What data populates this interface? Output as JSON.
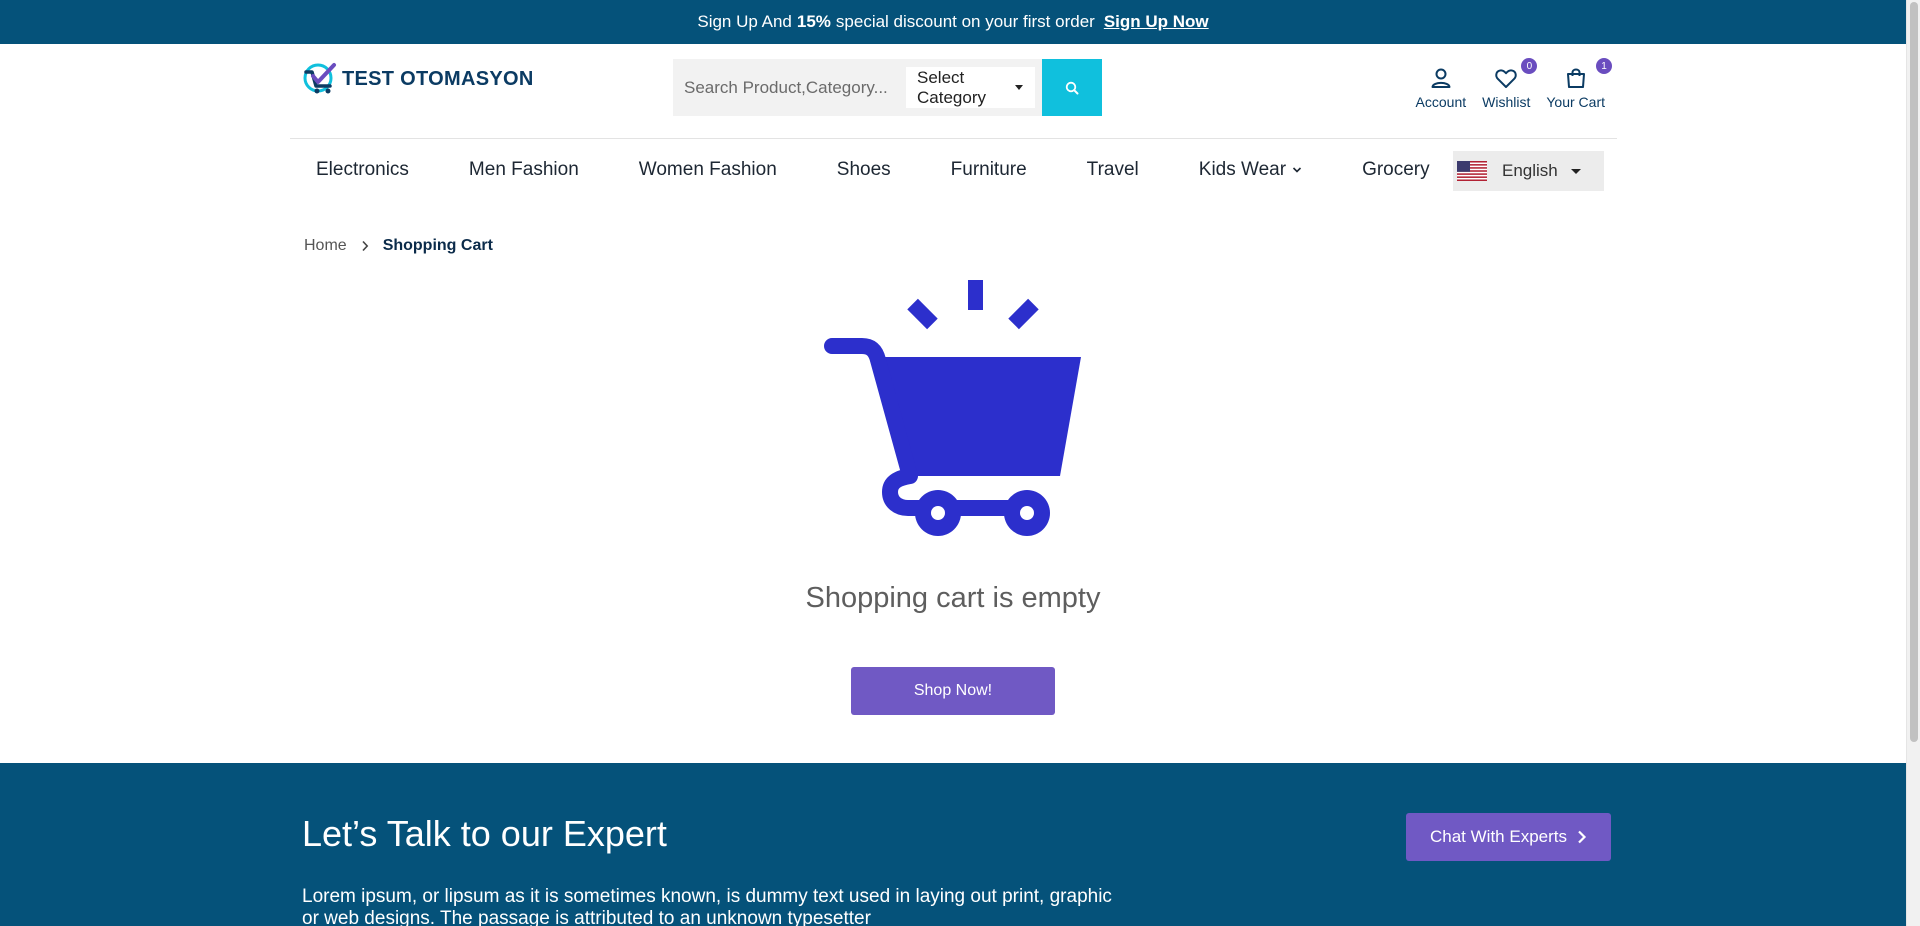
{
  "topbar": {
    "text_before": "Sign Up And",
    "discount": "15%",
    "text_after": "special discount on your first order",
    "link": "Sign Up Now"
  },
  "header": {
    "logo_text": "TEST OTOMASYON",
    "search_placeholder": "Search Product,Category...",
    "category_selected": "Select Category",
    "actions": [
      {
        "label": "Account",
        "icon": "user-icon"
      },
      {
        "label": "Wishlist",
        "icon": "heart-icon",
        "badge": "0"
      },
      {
        "label": "Your Cart",
        "icon": "bag-icon",
        "badge": "1"
      }
    ]
  },
  "nav": {
    "items": [
      {
        "label": "Electronics"
      },
      {
        "label": "Men Fashion"
      },
      {
        "label": "Women Fashion"
      },
      {
        "label": "Shoes"
      },
      {
        "label": "Furniture"
      },
      {
        "label": "Travel"
      },
      {
        "label": "Kids Wear"
      },
      {
        "label": "Grocery"
      }
    ],
    "language": "English"
  },
  "breadcrumb": {
    "home": "Home",
    "current": "Shopping Cart"
  },
  "cart": {
    "empty_message": "Shopping cart is empty",
    "shop_button": "Shop Now!",
    "illustration_color": "#2c2fcc"
  },
  "expert": {
    "title": "Let’s Talk to our Expert",
    "description": "Lorem ipsum, or lipsum as it is sometimes known, is dummy text used in laying out print, graphic or web designs. The passage is attributed to an unknown typesetter",
    "chat_button": "Chat With Experts"
  },
  "colors": {
    "primary_dark": "#05527a",
    "accent_purple": "#7059c4",
    "search_cyan": "#10c0dd"
  }
}
